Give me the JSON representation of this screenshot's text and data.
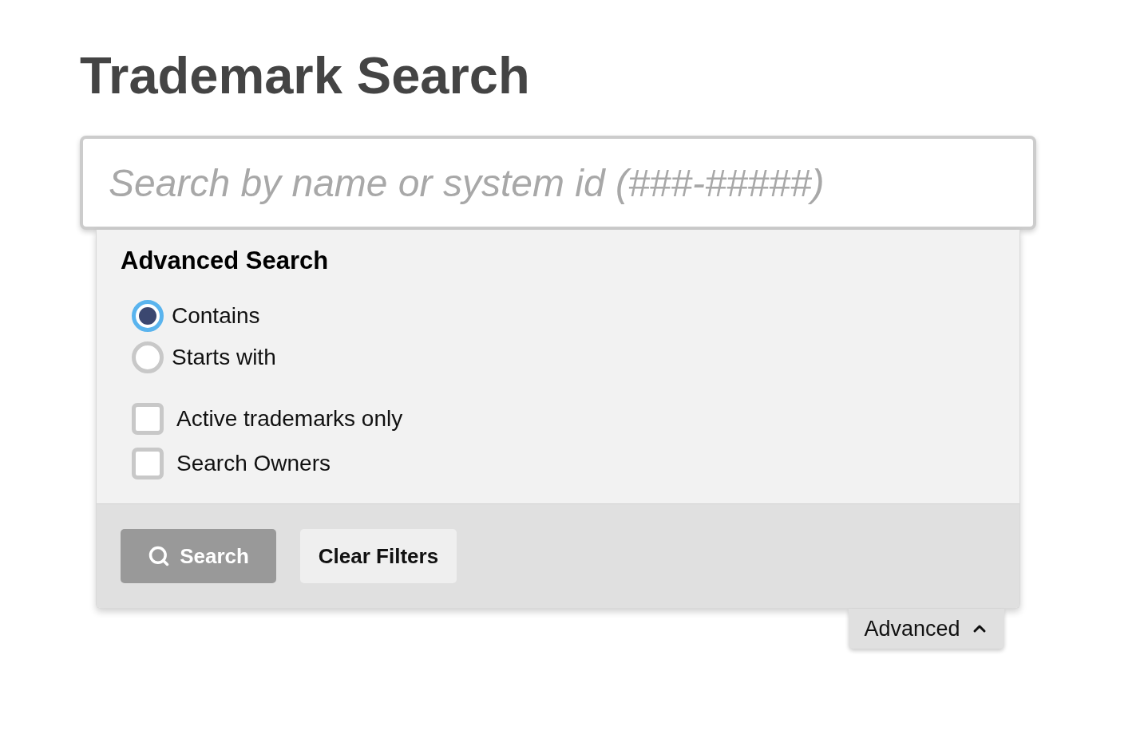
{
  "page": {
    "title": "Trademark Search"
  },
  "search_field": {
    "placeholder": "Search by name or system id (###-#####)"
  },
  "advanced_panel": {
    "title": "Advanced Search",
    "match_modes": [
      {
        "label": "Contains",
        "selected": true
      },
      {
        "label": "Starts with",
        "selected": false
      }
    ],
    "filters": [
      {
        "label": "Active trademarks only",
        "checked": false
      },
      {
        "label": "Search Owners",
        "checked": false
      }
    ],
    "buttons": [
      {
        "label": "Search",
        "kind": "primary"
      },
      {
        "label": "Clear Filters",
        "kind": "secondary"
      }
    ]
  },
  "advanced_toggle": {
    "label": "Advanced",
    "expanded": true
  }
}
